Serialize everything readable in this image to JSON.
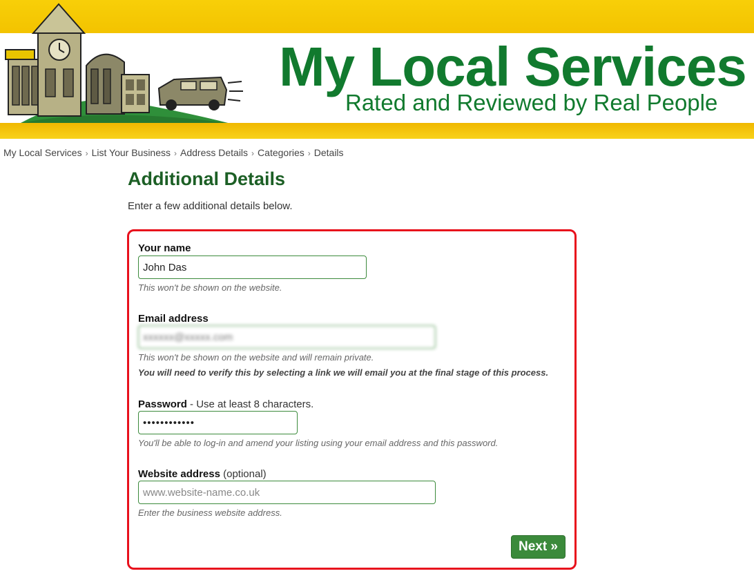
{
  "header": {
    "site_title": "My Local Services",
    "tagline": "Rated and Reviewed by Real People",
    "brand_green": "#117a2e",
    "brand_yellow": "#f6c700"
  },
  "breadcrumb": {
    "items": [
      "My Local Services",
      "List Your Business",
      "Address Details",
      "Categories",
      "Details"
    ],
    "separator": "›"
  },
  "page": {
    "title": "Additional Details",
    "intro": "Enter a few additional details below."
  },
  "form": {
    "name": {
      "label": "Your name",
      "value": "John Das",
      "help": "This won't be shown on the website."
    },
    "email": {
      "label": "Email address",
      "value": "xxxxxx@xxxxx.com",
      "help": "This won't be shown on the website and will remain private.",
      "help_bold": "You will need to verify this by selecting a link we will email you at the final stage of this process."
    },
    "password": {
      "label": "Password",
      "label_suffix": " - Use at least 8 characters.",
      "value": "••••••••••••",
      "help": "You'll be able to log-in and amend your listing using your email address and this password."
    },
    "website": {
      "label": "Website address",
      "label_suffix": " (optional)",
      "value": "",
      "placeholder": "www.website-name.co.uk",
      "help": "Enter the business website address."
    },
    "next_label": "Next »",
    "panel_border_color": "#e8101c"
  }
}
